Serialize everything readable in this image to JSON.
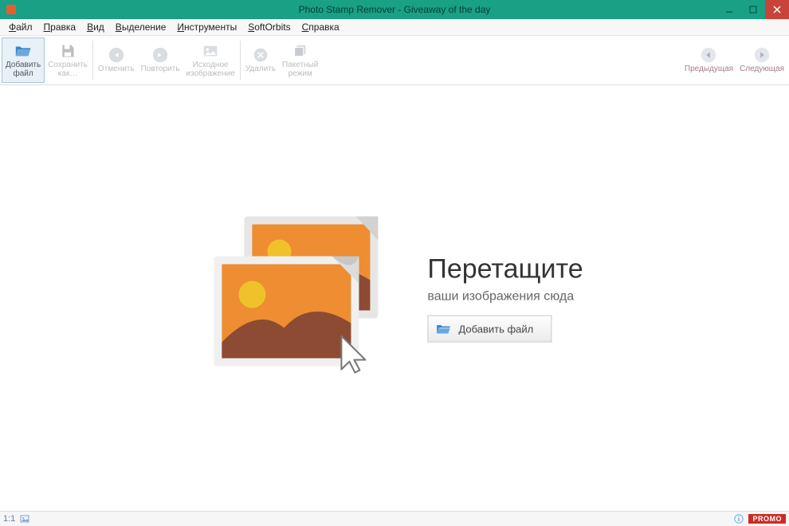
{
  "title": "Photo Stamp Remover - Giveaway of the day",
  "menu": {
    "items": [
      "Файл",
      "Правка",
      "Вид",
      "Выделение",
      "Инструменты",
      "SoftOrbits",
      "Справка"
    ]
  },
  "toolbar": {
    "add_file": "Добавить\nфайл",
    "save_as": "Сохранить\nкак…",
    "undo": "Отменить",
    "redo": "Повторить",
    "original": "Исходное\nизображение",
    "delete": "Удалить",
    "batch": "Пакетный\nрежим",
    "prev": "Предыдущая",
    "next": "Следующая"
  },
  "drop": {
    "headline": "Перетащите",
    "sub": "ваши изображения сюда",
    "button": "Добавить файл"
  },
  "status": {
    "zoom": "1:1",
    "promo": "PROMO"
  },
  "colors": {
    "titlebar": "#19a085",
    "close": "#c8443a",
    "accent_orange": "#ee8d31",
    "accent_brown": "#8d4b33",
    "sun": "#f0c12b"
  }
}
